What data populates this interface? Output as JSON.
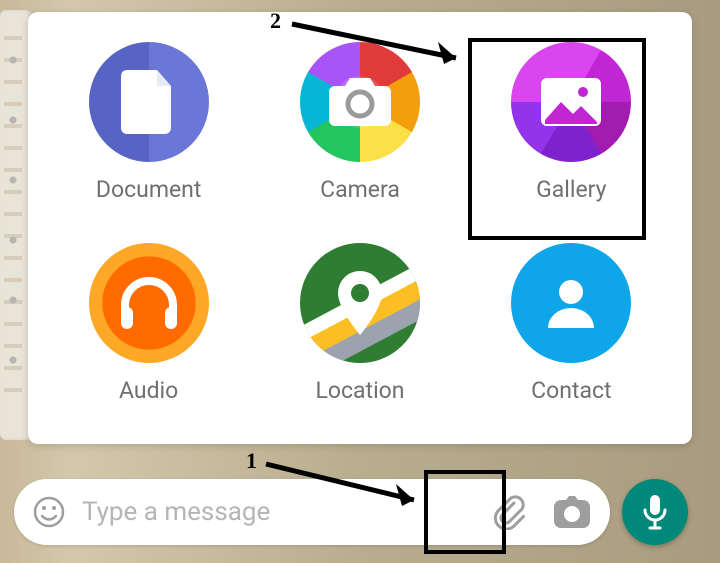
{
  "attachment_panel": {
    "items": [
      {
        "label": "Document"
      },
      {
        "label": "Camera"
      },
      {
        "label": "Gallery"
      },
      {
        "label": "Audio"
      },
      {
        "label": "Location"
      },
      {
        "label": "Contact"
      }
    ]
  },
  "input_bar": {
    "placeholder": "Type a message"
  },
  "annotations": {
    "step1": "1",
    "step2": "2"
  }
}
